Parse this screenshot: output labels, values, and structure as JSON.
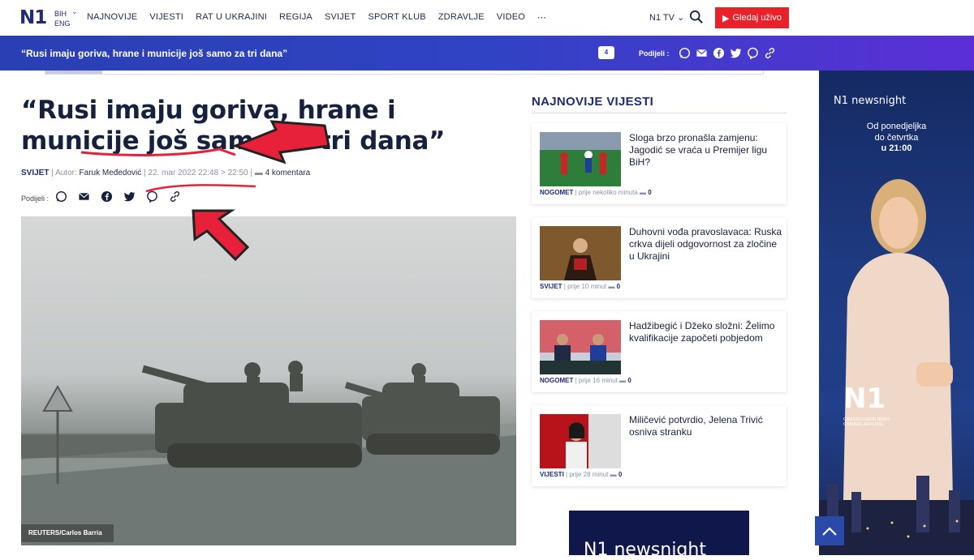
{
  "nav": {
    "logo": "N1",
    "lang_primary": "BIH",
    "lang_secondary": "ENG",
    "items": [
      "NAJNOVIJE",
      "VIJESTI",
      "RAT U UKRAJINI",
      "REGIJA",
      "SVIJET",
      "SPORT KLUB",
      "ZDRAVLJE",
      "VIDEO",
      "⋯"
    ],
    "tv_label": "N1 TV",
    "live_label": "Gledaj uživo"
  },
  "bar": {
    "title": "“Rusi imaju goriva, hrane i municije još samo za tri dana”",
    "comments_count": "4",
    "share_label": "Podijeli :"
  },
  "article": {
    "headline": "“Rusi imaju goriva, hrane i municije još samo za tri dana”",
    "category": "SVIJET",
    "author_prefix": "Autor:",
    "author": "Faruk Međedović",
    "date": "22. mar 2022",
    "time_from": "22:48",
    "time_to": "22:50",
    "time_arrow": ">",
    "comments": "4 komentara",
    "share_label": "Podijeli :",
    "image_credit": "REUTERS/Carlos Barria"
  },
  "sidebar": {
    "title": "NAJNOVIJE VIJESTI",
    "cards": [
      {
        "title": "Sloga brzo pronašla zamjenu: Jagodić se vraća u Premijer ligu BiH?",
        "category": "NOGOMET",
        "time": "prije nekoliko minuta",
        "comments": "0"
      },
      {
        "title": "Duhovni vođa pravoslavaca: Ruska crkva dijeli odgovornost za zločine u Ukrajini",
        "category": "SVIJET",
        "time": "prije 10 minut",
        "comments": "0"
      },
      {
        "title": "Hadžibegić i Džeko složni: Želimo kvalifikacije započeti pobjedom",
        "category": "NOGOMET",
        "time": "prije 16 minut",
        "comments": "0"
      },
      {
        "title": "Miličević potvrdio, Jelena Trivić osniva stranku",
        "category": "VIJESTI",
        "time": "prije 28 minut",
        "comments": "0"
      }
    ]
  },
  "promo": {
    "text": "N1 newsnight"
  },
  "ad": {
    "logo": "N1 newsnight",
    "line1": "Od ponedjeljka",
    "line2": "do četvrtka",
    "time": "u 21:00",
    "brand": "N1",
    "affiliate": "CNN EXCLUSIVE NEWS CHANNEL AFFILIATE"
  },
  "colors": {
    "brand": "#1f2a7a",
    "accent": "#e8212b",
    "bar": "#3043c4",
    "annotation": "#e8213a"
  }
}
